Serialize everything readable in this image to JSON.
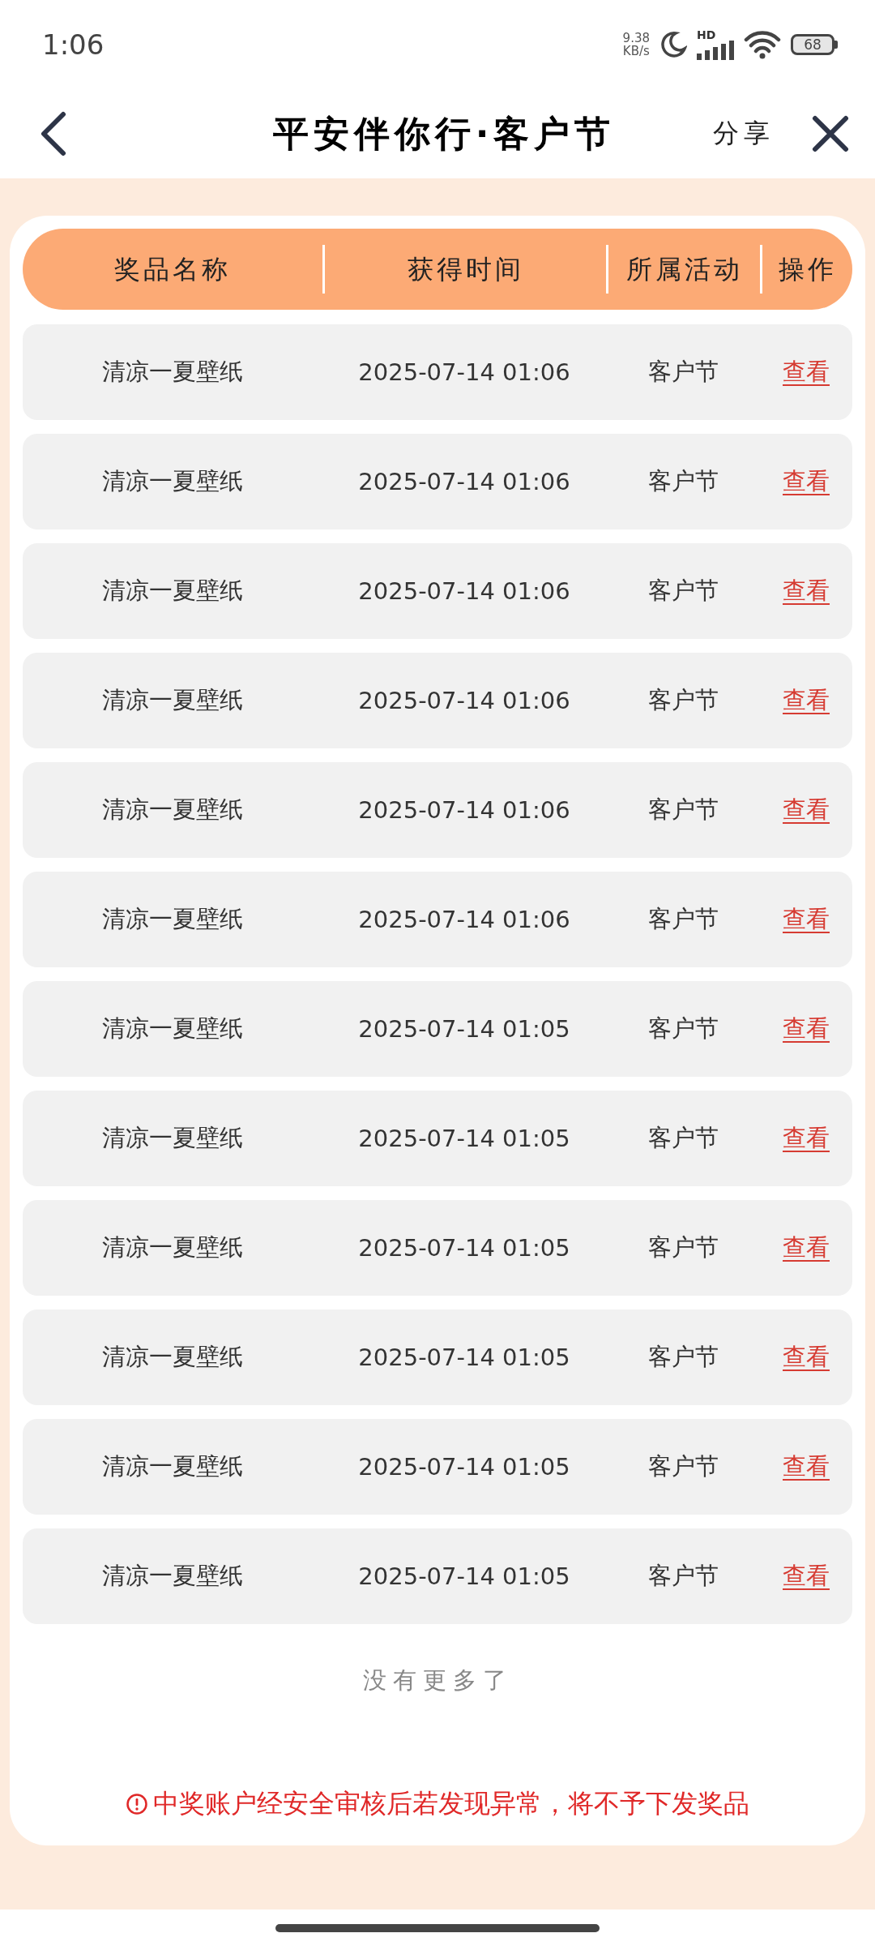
{
  "status_bar": {
    "time": "1:06",
    "net_speed": "9.38",
    "net_unit": "KB/s",
    "network_badge": "HD",
    "battery": "68"
  },
  "header": {
    "title": "平安伴你行·客户节",
    "share": "分享"
  },
  "table": {
    "columns": [
      "奖品名称",
      "获得时间",
      "所属活动",
      "操作"
    ],
    "rows": [
      {
        "name": "清凉一夏壁纸",
        "time": "2025-07-14 01:06",
        "activity": "客户节",
        "action": "查看"
      },
      {
        "name": "清凉一夏壁纸",
        "time": "2025-07-14 01:06",
        "activity": "客户节",
        "action": "查看"
      },
      {
        "name": "清凉一夏壁纸",
        "time": "2025-07-14 01:06",
        "activity": "客户节",
        "action": "查看"
      },
      {
        "name": "清凉一夏壁纸",
        "time": "2025-07-14 01:06",
        "activity": "客户节",
        "action": "查看"
      },
      {
        "name": "清凉一夏壁纸",
        "time": "2025-07-14 01:06",
        "activity": "客户节",
        "action": "查看"
      },
      {
        "name": "清凉一夏壁纸",
        "time": "2025-07-14 01:06",
        "activity": "客户节",
        "action": "查看"
      },
      {
        "name": "清凉一夏壁纸",
        "time": "2025-07-14 01:05",
        "activity": "客户节",
        "action": "查看"
      },
      {
        "name": "清凉一夏壁纸",
        "time": "2025-07-14 01:05",
        "activity": "客户节",
        "action": "查看"
      },
      {
        "name": "清凉一夏壁纸",
        "time": "2025-07-14 01:05",
        "activity": "客户节",
        "action": "查看"
      },
      {
        "name": "清凉一夏壁纸",
        "time": "2025-07-14 01:05",
        "activity": "客户节",
        "action": "查看"
      },
      {
        "name": "清凉一夏壁纸",
        "time": "2025-07-14 01:05",
        "activity": "客户节",
        "action": "查看"
      },
      {
        "name": "清凉一夏壁纸",
        "time": "2025-07-14 01:05",
        "activity": "客户节",
        "action": "查看"
      }
    ],
    "end_note": "没有更多了"
  },
  "warning": "中奖账户经安全审核后若发现异常，将不予下发奖品"
}
